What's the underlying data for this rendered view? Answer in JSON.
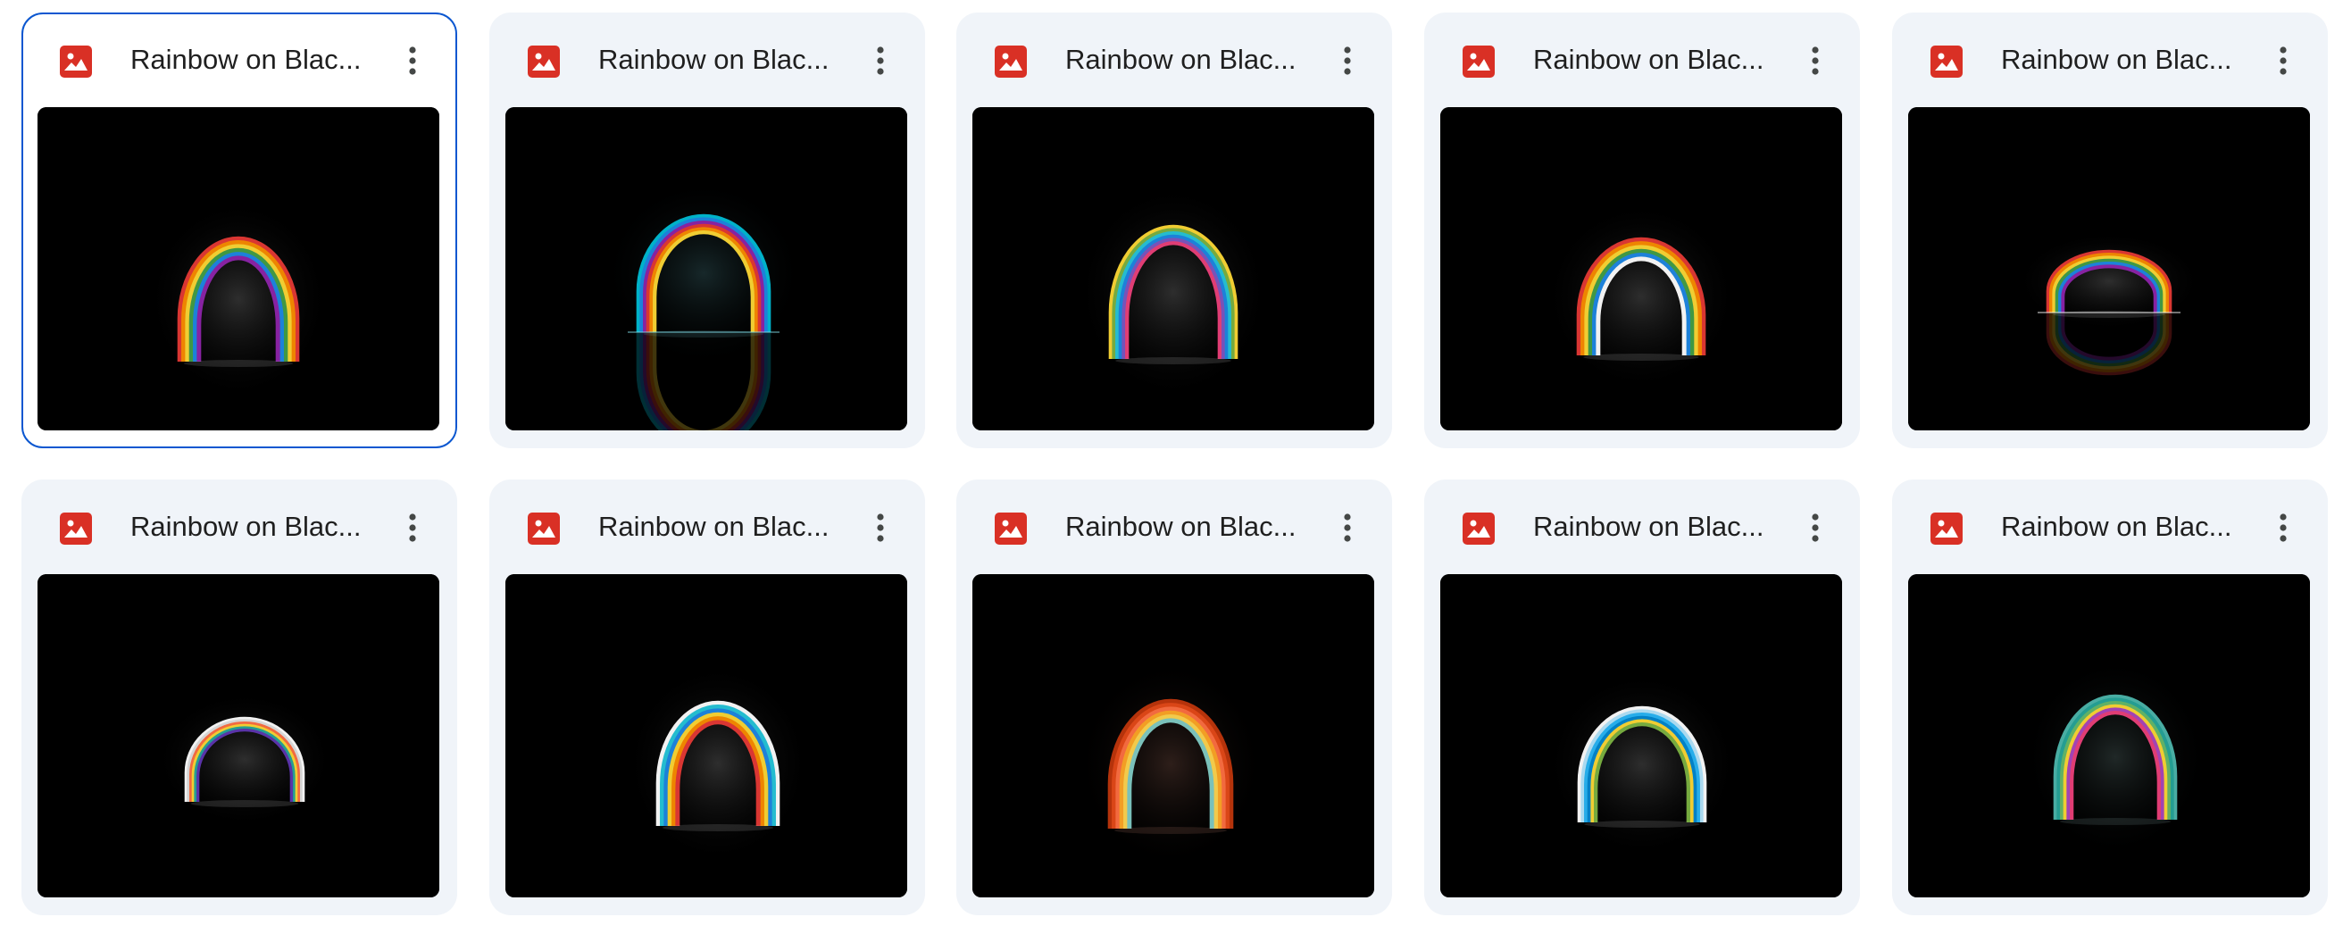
{
  "files": [
    {
      "name": "Rainbow on Blac...",
      "type_icon": "image-icon",
      "selected": true,
      "variant": 0
    },
    {
      "name": "Rainbow on Blac...",
      "type_icon": "image-icon",
      "selected": false,
      "variant": 1
    },
    {
      "name": "Rainbow on Blac...",
      "type_icon": "image-icon",
      "selected": false,
      "variant": 2
    },
    {
      "name": "Rainbow on Blac...",
      "type_icon": "image-icon",
      "selected": false,
      "variant": 3
    },
    {
      "name": "Rainbow on Blac...",
      "type_icon": "image-icon",
      "selected": false,
      "variant": 4
    },
    {
      "name": "Rainbow on Blac...",
      "type_icon": "image-icon",
      "selected": false,
      "variant": 5
    },
    {
      "name": "Rainbow on Blac...",
      "type_icon": "image-icon",
      "selected": false,
      "variant": 6
    },
    {
      "name": "Rainbow on Blac...",
      "type_icon": "image-icon",
      "selected": false,
      "variant": 7
    },
    {
      "name": "Rainbow on Blac...",
      "type_icon": "image-icon",
      "selected": false,
      "variant": 8
    },
    {
      "name": "Rainbow on Blac...",
      "type_icon": "image-icon",
      "selected": false,
      "variant": 9
    }
  ],
  "colors": {
    "card_bg": "#f0f4f9",
    "selected_border": "#0b57d0",
    "image_icon": "#d93025",
    "text": "#1f1f1f",
    "menu_icon": "#444746"
  },
  "menu_icon": "more-vert-icon"
}
